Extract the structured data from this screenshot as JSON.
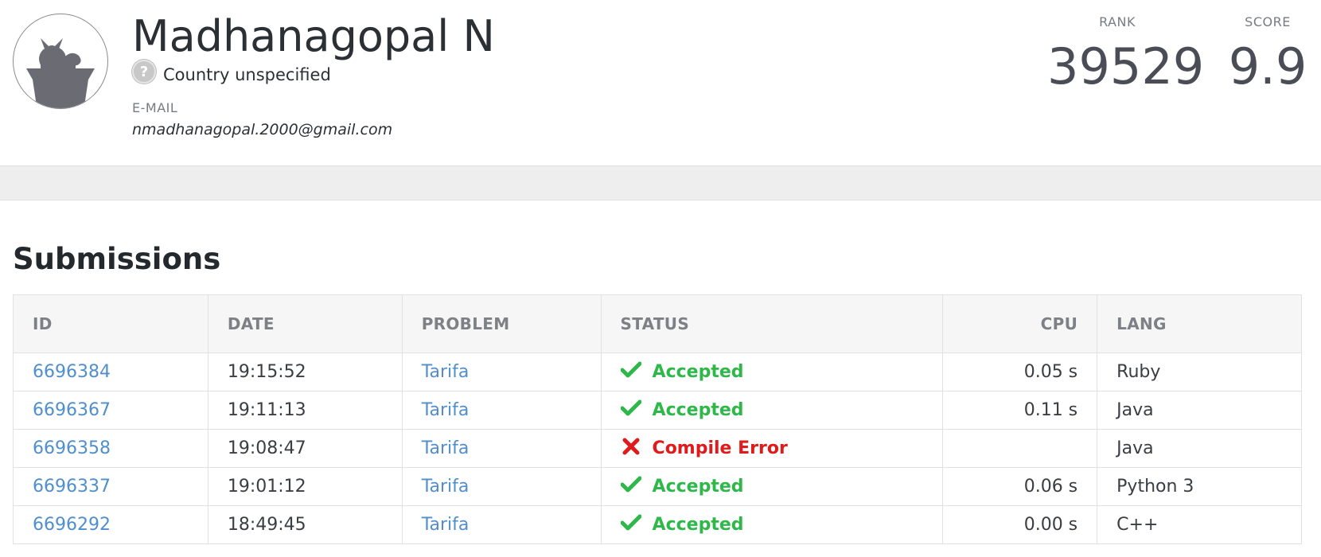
{
  "profile": {
    "name": "Madhanagopal N",
    "country": "Country unspecified",
    "email_label": "E-MAIL",
    "email": "nmadhanagopal.2000@gmail.com",
    "rank_label": "RANK",
    "rank": "39529",
    "score_label": "SCORE",
    "score": "9.9"
  },
  "submissions": {
    "title": "Submissions",
    "columns": [
      "ID",
      "DATE",
      "PROBLEM",
      "STATUS",
      "CPU",
      "LANG"
    ],
    "rows": [
      {
        "id": "6696384",
        "date": "19:15:52",
        "problem": "Tarifa",
        "status": "Accepted",
        "status_icon": "check-icon",
        "cpu": "0.05 s",
        "lang": "Ruby"
      },
      {
        "id": "6696367",
        "date": "19:11:13",
        "problem": "Tarifa",
        "status": "Accepted",
        "status_icon": "check-icon",
        "cpu": "0.11 s",
        "lang": "Java"
      },
      {
        "id": "6696358",
        "date": "19:08:47",
        "problem": "Tarifa",
        "status": "Compile Error",
        "status_icon": "cross-icon",
        "cpu": "",
        "lang": "Java"
      },
      {
        "id": "6696337",
        "date": "19:01:12",
        "problem": "Tarifa",
        "status": "Accepted",
        "status_icon": "check-icon",
        "cpu": "0.06 s",
        "lang": "Python 3"
      },
      {
        "id": "6696292",
        "date": "18:49:45",
        "problem": "Tarifa",
        "status": "Accepted",
        "status_icon": "check-icon",
        "cpu": "0.00 s",
        "lang": "C++"
      }
    ]
  },
  "colors": {
    "accepted": "#2fb84a",
    "error": "#e01b1b",
    "link": "#4f8fce"
  }
}
